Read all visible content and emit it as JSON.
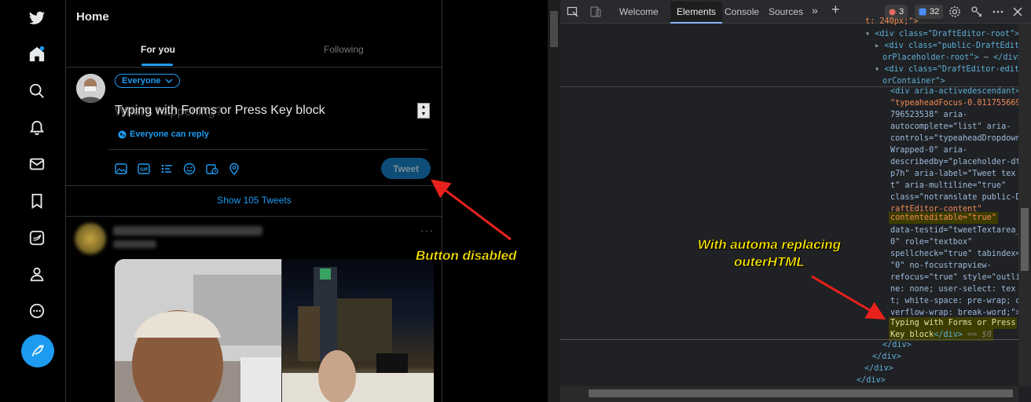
{
  "twitter": {
    "home_title": "Home",
    "tabs": [
      "For you",
      "Following"
    ],
    "audience_label": "Everyone",
    "placeholder_text": "What's happening?",
    "typed_text": "Typing with Forms or Press Key block",
    "reply_setting": "Everyone can reply",
    "tweet_button": "Tweet",
    "tweet_button_state": "disabled",
    "show_tweets": "Show 105 Tweets",
    "post_more": "···",
    "accent_color": "#1d9bf0",
    "nav_icons": [
      "twitter-logo-icon",
      "home-icon",
      "search-icon",
      "notifications-icon",
      "messages-icon",
      "bookmarks-icon",
      "twitter-blue-icon",
      "profile-icon",
      "more-icon",
      "compose-tweet-icon"
    ],
    "tool_icons": [
      "image-icon",
      "gif-icon",
      "poll-icon",
      "emoji-icon",
      "schedule-icon",
      "location-icon"
    ]
  },
  "annotations": {
    "button_disabled": "Button disabled",
    "automa_line1": "With automa replacing",
    "automa_line2": "outerHTML",
    "annotation_color": "#ffe600"
  },
  "devtools": {
    "tabs": [
      "Welcome",
      "Elements",
      "Console",
      "Sources"
    ],
    "error_count": "3",
    "issue_count": "32",
    "code_top": [
      "t: 240px;\">",
      "<div class=\"DraftEditor-root\">",
      "<div class=\"public-DraftEdit",
      "orPlaceholder-root\">",
      "</div>",
      "<div class=\"DraftEditor-edit",
      "orContainer\">"
    ],
    "code_main": [
      "<div aria-activedescendant=",
      "\"typeaheadFocus-0.011755669",
      "796523538\" aria-",
      "autocomplete=\"list\" aria-",
      "controls=\"typeaheadDropdown",
      "Wrapped-0\" aria-",
      "describedby=\"placeholder-dt",
      "p7h\" aria-label=\"Tweet tex",
      "t\" aria-multiline=\"true\"",
      "class=\"notranslate public-D",
      "raftEditor-content\"",
      "contenteditable=\"true\"",
      "data-testid=\"tweetTextarea_",
      "0\" role=\"textbox\"",
      "spellcheck=\"true\" tabindex=",
      "\"0\" no-focustrapview-",
      "refocus=\"true\" style=\"outli",
      "ne: none; user-select: tex",
      "t; white-space: pre-wrap; o",
      "verflow-wrap: break-word;\">"
    ],
    "selected_line1": "Typing with Forms or Press",
    "selected_line2": "Key block",
    "selected_close": "</div>",
    "selected_marker": "== $0",
    "closing_tags": [
      "</div>",
      "</div>",
      "</div>",
      "</div>"
    ]
  }
}
